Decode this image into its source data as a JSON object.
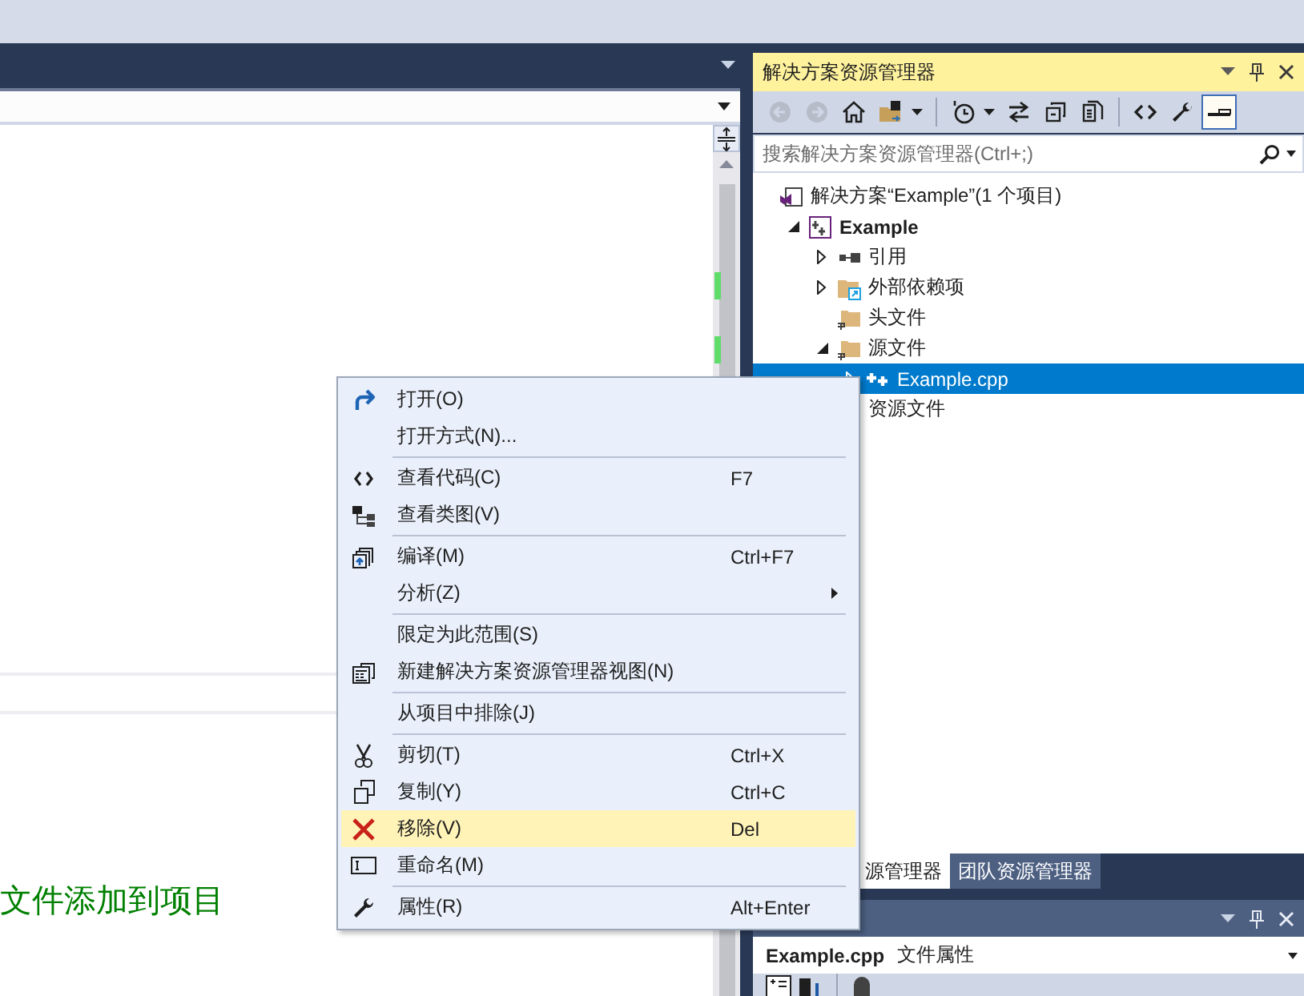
{
  "editor": {
    "message": "文件添加到项目"
  },
  "explorer": {
    "title": "解决方案资源管理器",
    "toolbar": [
      {
        "kind": "back",
        "disabled": true,
        "pressed": false
      },
      {
        "kind": "forward",
        "disabled": true,
        "pressed": false
      },
      {
        "kind": "home",
        "disabled": false,
        "pressed": false
      },
      {
        "kind": "sync-folder",
        "disabled": false,
        "pressed": false
      },
      {
        "kind": "dropdown"
      },
      {
        "kind": "separator"
      },
      {
        "kind": "history",
        "disabled": false,
        "pressed": false
      },
      {
        "kind": "dropdown"
      },
      {
        "kind": "sync",
        "disabled": false,
        "pressed": false
      },
      {
        "kind": "collapse",
        "disabled": false,
        "pressed": false
      },
      {
        "kind": "show-all",
        "disabled": false,
        "pressed": false
      },
      {
        "kind": "separator"
      },
      {
        "kind": "code",
        "disabled": false,
        "pressed": false
      },
      {
        "kind": "properties",
        "disabled": false,
        "pressed": false
      },
      {
        "kind": "preview",
        "disabled": false,
        "pressed": true
      }
    ],
    "search": {
      "placeholder": "搜索解决方案资源管理器(Ctrl+;)"
    },
    "tree": [
      {
        "kind": "solution",
        "label": "解决方案“Example”(1 个项目)",
        "selected": false,
        "children": [
          {
            "kind": "project",
            "label": "Example",
            "startup": true,
            "expanded": true,
            "selected": false,
            "children": [
              {
                "kind": "references",
                "label": "引用",
                "expanded": false,
                "selected": false
              },
              {
                "kind": "external",
                "label": "外部依赖项",
                "expanded": false,
                "selected": false
              },
              {
                "kind": "filter",
                "label": "头文件",
                "selected": false
              },
              {
                "kind": "filter",
                "label": "源文件",
                "expanded": true,
                "selected": false,
                "children": [
                  {
                    "kind": "cpp",
                    "label": "Example.cpp",
                    "expanded": false,
                    "selected": true
                  }
                ]
              },
              {
                "kind": "plain",
                "label": "资源文件",
                "selected": false
              }
            ]
          }
        ]
      }
    ],
    "tabs": [
      {
        "label": "源管理器",
        "selected": true
      },
      {
        "label": "团队资源管理器",
        "selected": false
      }
    ]
  },
  "properties": {
    "object": "Example.cpp",
    "type": "文件属性"
  },
  "context_menu": [
    {
      "kind": "open",
      "label": "打开(O)",
      "selected": false
    },
    {
      "kind": "plain",
      "label": "打开方式(N)...",
      "selected": false
    },
    {
      "kind": "separator"
    },
    {
      "kind": "code",
      "label": "查看代码(C)",
      "shortcut": "F7",
      "selected": false
    },
    {
      "kind": "class-diagram",
      "label": "查看类图(V)",
      "selected": false
    },
    {
      "kind": "separator"
    },
    {
      "kind": "compile",
      "label": "编译(M)",
      "shortcut": "Ctrl+F7",
      "selected": false
    },
    {
      "kind": "plain",
      "label": "分析(Z)",
      "submenu": true,
      "selected": false
    },
    {
      "kind": "separator"
    },
    {
      "kind": "plain",
      "label": "限定为此范围(S)",
      "selected": false
    },
    {
      "kind": "new-view",
      "label": "新建解决方案资源管理器视图(N)",
      "selected": false
    },
    {
      "kind": "separator"
    },
    {
      "kind": "plain",
      "label": "从项目中排除(J)",
      "selected": false
    },
    {
      "kind": "separator"
    },
    {
      "kind": "cut",
      "label": "剪切(T)",
      "shortcut": "Ctrl+X",
      "selected": false
    },
    {
      "kind": "copy",
      "label": "复制(Y)",
      "shortcut": "Ctrl+C",
      "selected": false
    },
    {
      "kind": "remove",
      "label": "移除(V)",
      "shortcut": "Del",
      "selected": true
    },
    {
      "kind": "rename",
      "label": "重命名(M)",
      "selected": false
    },
    {
      "kind": "separator"
    },
    {
      "kind": "properties",
      "label": "属性(R)",
      "shortcut": "Alt+Enter",
      "selected": false
    }
  ]
}
